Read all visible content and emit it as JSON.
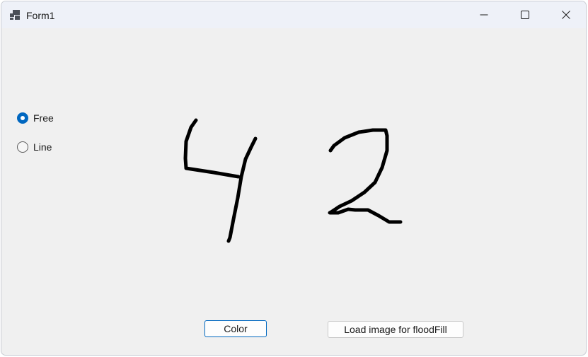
{
  "window": {
    "title": "Form1",
    "controls": {
      "minimize_icon": "minimize-icon",
      "maximize_icon": "maximize-icon",
      "close_icon": "close-icon"
    }
  },
  "mode": {
    "options": [
      {
        "label": "Free",
        "checked": true
      },
      {
        "label": "Line",
        "checked": false
      }
    ]
  },
  "buttons": {
    "color_label": "Color",
    "load_label": "Load image for floodFill"
  },
  "canvas": {
    "stroke_color": "#000000",
    "drawn_content": "42"
  },
  "colors": {
    "accent": "#0067c0",
    "window_bg": "#f0f0f0",
    "titlebar_bg": "#eef1f8"
  }
}
